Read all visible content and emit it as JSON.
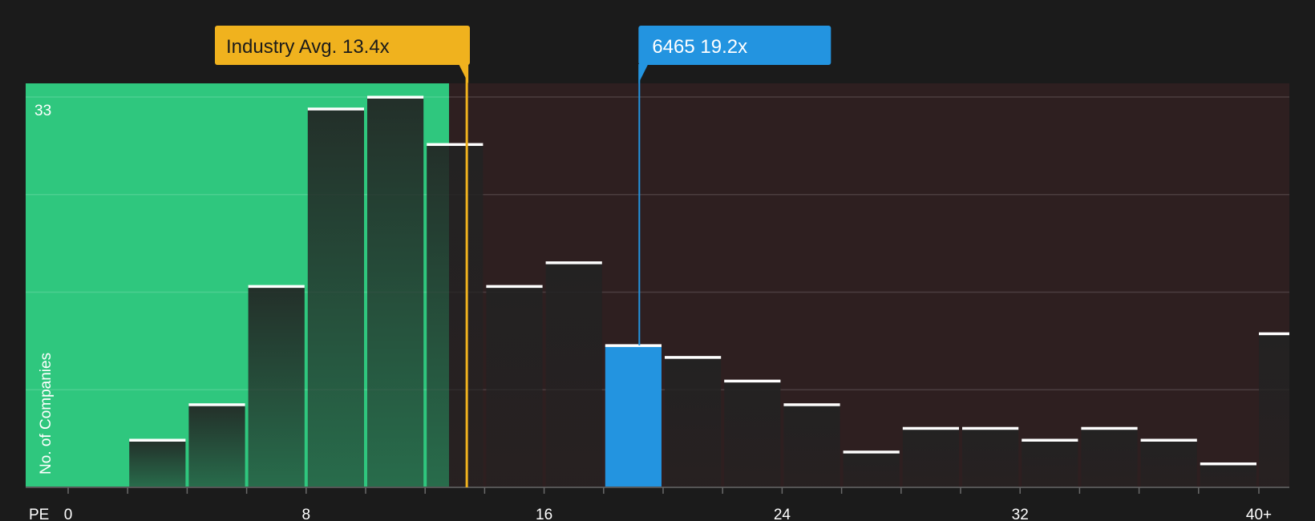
{
  "chart_data": {
    "type": "bar",
    "xlabel": "PE",
    "ylabel": "No. of Companies",
    "ymax_label": "33",
    "ylim": [
      0,
      33
    ],
    "grid": true,
    "x_ticks": [
      "0",
      "8",
      "16",
      "24",
      "32",
      "40+"
    ],
    "bins": [
      {
        "x_start": 0,
        "x_end": 2,
        "value": 0
      },
      {
        "x_start": 2,
        "x_end": 4,
        "value": 4
      },
      {
        "x_start": 4,
        "x_end": 6,
        "value": 7
      },
      {
        "x_start": 6,
        "x_end": 8,
        "value": 17
      },
      {
        "x_start": 8,
        "x_end": 10,
        "value": 32
      },
      {
        "x_start": 10,
        "x_end": 12,
        "value": 33
      },
      {
        "x_start": 12,
        "x_end": 14,
        "value": 29
      },
      {
        "x_start": 14,
        "x_end": 16,
        "value": 17
      },
      {
        "x_start": 16,
        "x_end": 18,
        "value": 19
      },
      {
        "x_start": 18,
        "x_end": 20,
        "value": 12
      },
      {
        "x_start": 20,
        "x_end": 22,
        "value": 11
      },
      {
        "x_start": 22,
        "x_end": 24,
        "value": 9
      },
      {
        "x_start": 24,
        "x_end": 26,
        "value": 7
      },
      {
        "x_start": 26,
        "x_end": 28,
        "value": 3
      },
      {
        "x_start": 28,
        "x_end": 30,
        "value": 5
      },
      {
        "x_start": 30,
        "x_end": 32,
        "value": 5
      },
      {
        "x_start": 32,
        "x_end": 34,
        "value": 4
      },
      {
        "x_start": 34,
        "x_end": 36,
        "value": 5
      },
      {
        "x_start": 36,
        "x_end": 38,
        "value": 4
      },
      {
        "x_start": 38,
        "x_end": 40,
        "value": 2
      },
      {
        "x_start": 40,
        "x_end": 41,
        "value": 13
      }
    ],
    "highlight_bin": 9,
    "industry_avg": {
      "label": "Industry Avg. 13.4x",
      "value": 13.4
    },
    "company": {
      "label": "6465 19.2x",
      "value": 19.2
    },
    "colors": {
      "background": "#1b1b1b",
      "undervalued_zone": "#2fc77e",
      "overvalued_zone": "#2e1f20",
      "bar_dark": "#242424",
      "bar_highlight": "#2394e0",
      "bar_top": "#ffffff",
      "avg_marker": "#f0b21e",
      "company_marker": "#2394e0",
      "text": "#ffffff"
    }
  }
}
